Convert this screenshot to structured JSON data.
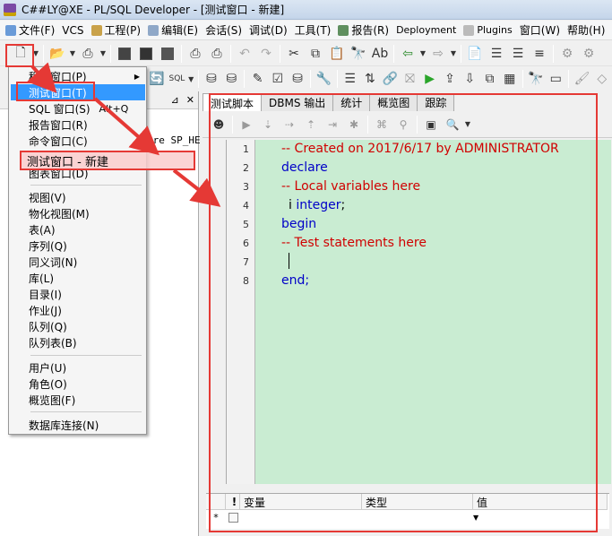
{
  "window": {
    "title": "C##LY@XE - PL/SQL Developer - [测试窗口 - 新建]"
  },
  "menubar": [
    {
      "label": "文件(F)"
    },
    {
      "label": "VCS"
    },
    {
      "label": "工程(P)"
    },
    {
      "label": "编辑(E)"
    },
    {
      "label": "会话(S)"
    },
    {
      "label": "调试(D)"
    },
    {
      "label": "工具(T)"
    },
    {
      "label": "报告(R)"
    },
    {
      "label": "Deployment"
    },
    {
      "label": "Plugins"
    },
    {
      "label": "窗口(W)"
    },
    {
      "label": "帮助(H)"
    }
  ],
  "dropdown": {
    "items": [
      {
        "label": "程序窗口(P)",
        "submenu": true
      },
      {
        "label": "测试窗口(T)",
        "highlighted": true
      },
      {
        "label": "SQL 窗口(S)",
        "shortcut": "Alt+Q"
      },
      {
        "label": "报告窗口(R)"
      },
      {
        "label": "命令窗口(C)"
      },
      {
        "label": "图表窗口(D)"
      },
      {
        "label": "视图(V)"
      },
      {
        "label": "物化视图(M)"
      },
      {
        "label": "表(A)"
      },
      {
        "label": "序列(Q)"
      },
      {
        "label": "同义词(N)"
      },
      {
        "label": "库(L)"
      },
      {
        "label": "目录(I)"
      },
      {
        "label": "作业(J)"
      },
      {
        "label": "队列(Q)"
      },
      {
        "label": "队列表(B)"
      },
      {
        "label": "用户(U)"
      },
      {
        "label": "角色(O)"
      },
      {
        "label": "概览图(F)"
      },
      {
        "label": "数据库连接(N)"
      }
    ]
  },
  "left_panel": {
    "partial_text": "ure SP_HE"
  },
  "callout": {
    "label": "测试窗口 - 新建"
  },
  "tabs": [
    {
      "label": "测试脚本",
      "active": true
    },
    {
      "label": "DBMS 输出"
    },
    {
      "label": "统计"
    },
    {
      "label": "概览图"
    },
    {
      "label": "跟踪"
    }
  ],
  "editor": {
    "lines": [
      {
        "n": "1",
        "text": "-- Created on 2017/6/17 by ADMINISTRATOR",
        "kind": "comment"
      },
      {
        "n": "2",
        "text": "declare",
        "kind": "keyword"
      },
      {
        "n": "3",
        "text": "  -- Local variables here",
        "kind": "comment"
      },
      {
        "n": "4",
        "text": "  i integer;",
        "kind": "mixed"
      },
      {
        "n": "5",
        "text": "begin",
        "kind": "keyword"
      },
      {
        "n": "6",
        "text": "  -- Test statements here",
        "kind": "comment"
      },
      {
        "n": "7",
        "text": "",
        "kind": "plain"
      },
      {
        "n": "8",
        "text": "end;",
        "kind": "keyword"
      }
    ],
    "line4_var": "i",
    "line4_type": "integer",
    "line4_end": ";"
  },
  "vars_grid": {
    "headers": [
      "变量",
      "类型",
      "值"
    ],
    "row_marker": "*"
  },
  "colors": {
    "editor_bg": "#c9ecd2",
    "comment": "#d00000",
    "keyword": "#0000c8",
    "highlight": "#3399ff",
    "annotation": "#e53935"
  }
}
